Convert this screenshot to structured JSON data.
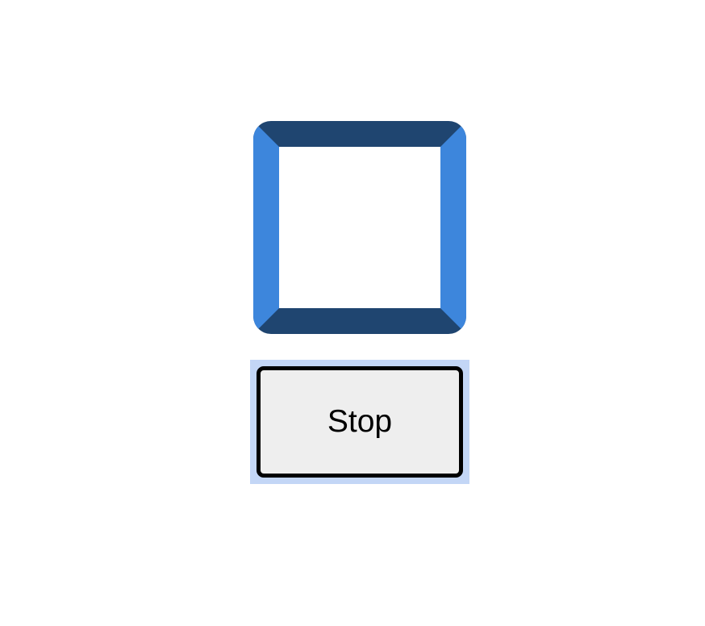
{
  "colors": {
    "box_border_light": "#3d86dc",
    "box_border_dark": "#1f4570",
    "box_fill": "#ffffff",
    "button_background": "#eeeeee",
    "button_border": "#000000",
    "focus_highlight": "#c3d6f6",
    "page_background": "#ffffff"
  },
  "controls": {
    "stop_label": "Stop"
  }
}
